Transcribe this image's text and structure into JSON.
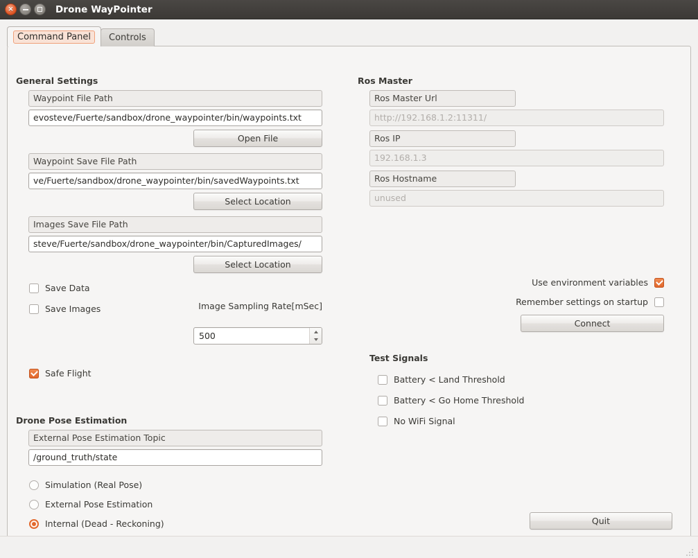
{
  "window": {
    "title": "Drone WayPointer",
    "controls": {
      "close": "close-icon",
      "minimize": "minimize-icon",
      "maximize": "maximize-icon"
    }
  },
  "tabs": [
    {
      "label": "Command Panel",
      "active": true
    },
    {
      "label": "Controls",
      "active": false
    }
  ],
  "general_settings": {
    "heading": "General Settings",
    "waypoint_file": {
      "label": "Waypoint File Path",
      "value": "evosteve/Fuerte/sandbox/drone_waypointer/bin/waypoints.txt",
      "button": "Open File"
    },
    "waypoint_save_file": {
      "label": "Waypoint Save File Path",
      "value": "ve/Fuerte/sandbox/drone_waypointer/bin/savedWaypoints.txt",
      "button": "Select Location"
    },
    "images_save_file": {
      "label": "Images Save File Path",
      "value": "steve/Fuerte/sandbox/drone_waypointer/bin/CapturedImages/",
      "button": "Select Location"
    },
    "save_data": {
      "label": "Save Data",
      "checked": false
    },
    "save_images": {
      "label": "Save Images",
      "checked": false
    },
    "sampling_rate": {
      "label": "Image Sampling Rate[mSec]",
      "value": "500"
    },
    "safe_flight": {
      "label": "Safe Flight",
      "checked": true
    }
  },
  "drone_pose_estimation": {
    "heading": "Drone Pose Estimation",
    "topic": {
      "label": "External Pose Estimation Topic",
      "value": "/ground_truth/state"
    },
    "options": [
      {
        "label": "Simulation (Real Pose)",
        "selected": false
      },
      {
        "label": "External Pose Estimation",
        "selected": false
      },
      {
        "label": "Internal (Dead - Reckoning)",
        "selected": true
      }
    ]
  },
  "ros_master": {
    "heading": "Ros Master",
    "url": {
      "label": "Ros Master Url",
      "placeholder": "http://192.168.1.2:11311/"
    },
    "ip": {
      "label": "Ros IP",
      "placeholder": "192.168.1.3"
    },
    "hostname": {
      "label": "Ros Hostname",
      "placeholder": "unused"
    },
    "use_env_vars": {
      "label": "Use environment variables",
      "checked": true
    },
    "remember_settings": {
      "label": "Remember settings on startup",
      "checked": false
    },
    "connect_button": "Connect"
  },
  "test_signals": {
    "heading": "Test Signals",
    "items": [
      {
        "label": "Battery < Land Threshold",
        "checked": false
      },
      {
        "label": "Battery < Go Home Threshold",
        "checked": false
      },
      {
        "label": "No WiFi Signal",
        "checked": false
      }
    ]
  },
  "quit_button": "Quit",
  "colors": {
    "accent": "#e2682c",
    "titlebar": "#3c3936",
    "panel": "#f6f5f4",
    "window": "#f2f1f0"
  }
}
